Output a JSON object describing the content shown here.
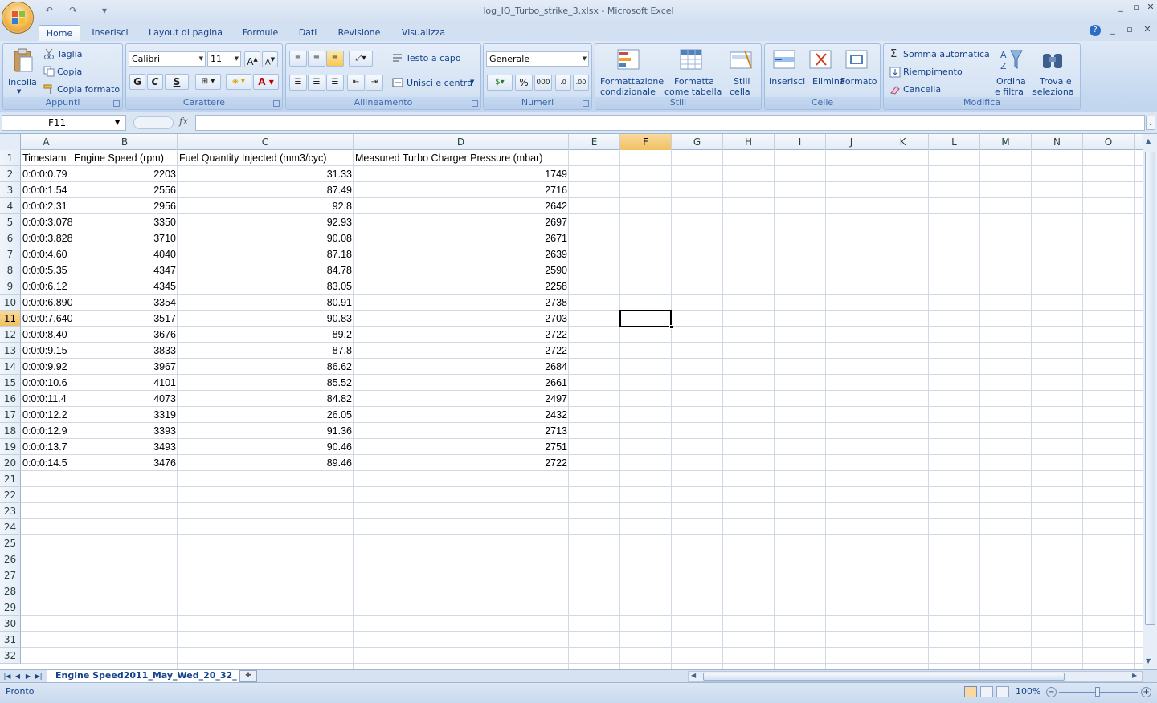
{
  "window": {
    "title": "log_IQ_Turbo_strike_3.xlsx - Microsoft Excel",
    "qat_undo": "↶",
    "qat_redo": "↷",
    "qat_more": "▾"
  },
  "tabs": [
    "Home",
    "Inserisci",
    "Layout di pagina",
    "Formule",
    "Dati",
    "Revisione",
    "Visualizza"
  ],
  "ribbon": {
    "appunti": {
      "label": "Appunti",
      "incolla": "Incolla",
      "taglia": "Taglia",
      "copia": "Copia",
      "copia_formato": "Copia formato"
    },
    "carattere": {
      "label": "Carattere",
      "font": "Calibri",
      "size": "11",
      "bold": "G",
      "italic": "C",
      "underline": "S"
    },
    "allineamento": {
      "label": "Allineamento",
      "testo_a_capo": "Testo a capo",
      "unisci": "Unisci e centra"
    },
    "numeri": {
      "label": "Numeri",
      "format": "Generale",
      "percent": "%",
      "thousands": "000"
    },
    "stili": {
      "label": "Stili",
      "formattazione_1": "Formattazione",
      "formattazione_2": "condizionale",
      "formatta_1": "Formatta",
      "formatta_2": "come tabella",
      "stili_1": "Stili",
      "stili_2": "cella"
    },
    "celle": {
      "label": "Celle",
      "inserisci": "Inserisci",
      "elimina": "Elimina",
      "formato": "Formato"
    },
    "modifica": {
      "label": "Modifica",
      "somma": "Somma automatica",
      "riempimento": "Riempimento",
      "cancella": "Cancella",
      "ordina_1": "Ordina",
      "ordina_2": "e filtra",
      "trova_1": "Trova e",
      "trova_2": "seleziona"
    }
  },
  "formula_bar": {
    "name_box": "F11",
    "fx": "fx",
    "formula": ""
  },
  "columns": [
    "A",
    "B",
    "C",
    "D",
    "E",
    "F",
    "G",
    "H",
    "I",
    "J",
    "K",
    "L",
    "M",
    "N",
    "O"
  ],
  "selected_column": "F",
  "selected_row": "11",
  "rows": [
    "1",
    "2",
    "3",
    "4",
    "5",
    "6",
    "7",
    "8",
    "9",
    "10",
    "11",
    "12",
    "13",
    "14",
    "15",
    "16",
    "17",
    "18",
    "19",
    "20",
    "21",
    "22",
    "23",
    "24",
    "25",
    "26",
    "27",
    "28",
    "29",
    "30",
    "31",
    "32"
  ],
  "headers": [
    "Timestam",
    "Engine Speed (rpm)",
    "Fuel Quantity Injected (mm3/cyc)",
    "Measured Turbo Charger Pressure (mbar)"
  ],
  "data": [
    [
      "0:0:0:0.79",
      "2203",
      "31.33",
      "1749"
    ],
    [
      "0:0:0:1.54",
      "2556",
      "87.49",
      "2716"
    ],
    [
      "0:0:0:2.31",
      "2956",
      "92.8",
      "2642"
    ],
    [
      "0:0:0:3.078",
      "3350",
      "92.93",
      "2697"
    ],
    [
      "0:0:0:3.828",
      "3710",
      "90.08",
      "2671"
    ],
    [
      "0:0:0:4.60",
      "4040",
      "87.18",
      "2639"
    ],
    [
      "0:0:0:5.35",
      "4347",
      "84.78",
      "2590"
    ],
    [
      "0:0:0:6.12",
      "4345",
      "83.05",
      "2258"
    ],
    [
      "0:0:0:6.890",
      "3354",
      "80.91",
      "2738"
    ],
    [
      "0:0:0:7.640",
      "3517",
      "90.83",
      "2703"
    ],
    [
      "0:0:0:8.40",
      "3676",
      "89.2",
      "2722"
    ],
    [
      "0:0:0:9.15",
      "3833",
      "87.8",
      "2722"
    ],
    [
      "0:0:0:9.92",
      "3967",
      "86.62",
      "2684"
    ],
    [
      "0:0:0:10.6",
      "4101",
      "85.52",
      "2661"
    ],
    [
      "0:0:0:11.4",
      "4073",
      "84.82",
      "2497"
    ],
    [
      "0:0:0:12.2",
      "3319",
      "26.05",
      "2432"
    ],
    [
      "0:0:0:12.9",
      "3393",
      "91.36",
      "2713"
    ],
    [
      "0:0:0:13.7",
      "3493",
      "90.46",
      "2751"
    ],
    [
      "0:0:0:14.5",
      "3476",
      "89.46",
      "2722"
    ]
  ],
  "sheet_tab": "Engine Speed2011_May_Wed_20_32_",
  "status": {
    "text": "Pronto",
    "zoom": "100%"
  }
}
